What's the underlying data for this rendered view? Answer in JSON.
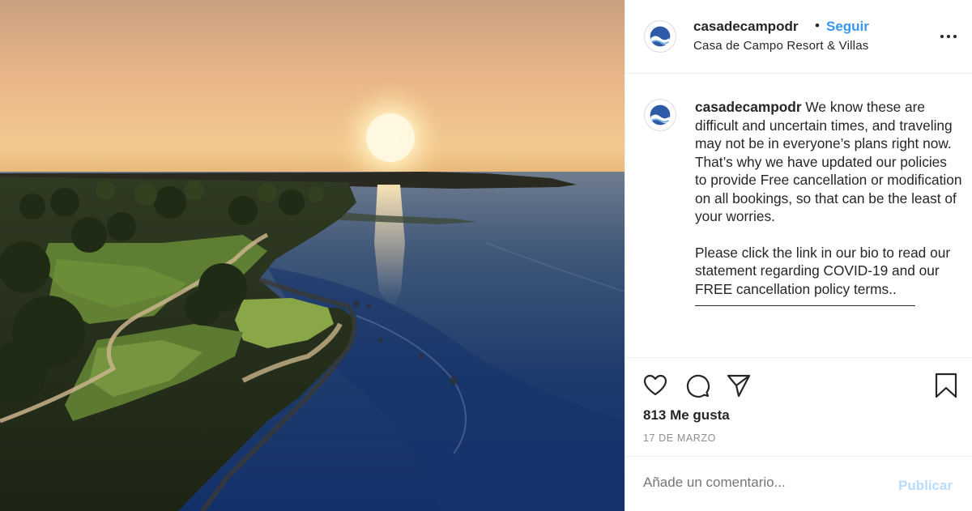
{
  "post": {
    "username": "casadecampodr",
    "separator": "•",
    "follow_label": "Seguir",
    "location": "Casa de Campo Resort & Villas",
    "caption_user": "casadecampodr",
    "caption_p1": "We know these are difficult and uncertain times, and traveling may not be in everyone’s plans right now. That’s why we have updated our policies to provide Free cancellation or modification on all bookings, so that can be the least of your worries.",
    "caption_p2": "Please click the link in our bio to read our statement regarding COVID-19 and our FREE cancellation policy terms..",
    "likes": "813 Me gusta",
    "date": "17 DE MARZO",
    "comment_placeholder": "Añade un comentario...",
    "publish_label": "Publicar"
  },
  "icons": {
    "like": "heart-icon",
    "comment": "comment-bubble-icon",
    "share": "paper-plane-icon",
    "save": "bookmark-icon",
    "more": "more-options-icon"
  },
  "colors": {
    "link_blue": "#3897f0",
    "publish_disabled": "#b9dcfb",
    "muted_text": "#8e8e8e"
  }
}
